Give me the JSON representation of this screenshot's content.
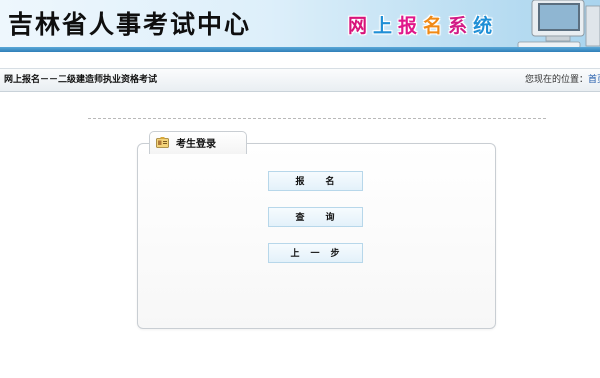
{
  "header": {
    "site_title": "吉林省人事考试中心",
    "system_title_chars": [
      "网",
      "上",
      "报",
      "名",
      "系",
      "统"
    ]
  },
  "navbar": {
    "title": "网上报名－－二级建造师执业资格考试",
    "location_label": "您现在的位置：",
    "location_link": "首页"
  },
  "panel": {
    "title": "考生登录",
    "buttons": {
      "signup": "报　　名",
      "query": "查　　询",
      "back": "上　一　步"
    }
  },
  "colors": {
    "banner_light": "#eef7fd",
    "banner_accent": "#2f7fb8",
    "button_border": "#b7d7ea",
    "link": "#1a56a8"
  },
  "icons": {
    "tab": "id-card-icon",
    "banner": "computer-icon"
  }
}
